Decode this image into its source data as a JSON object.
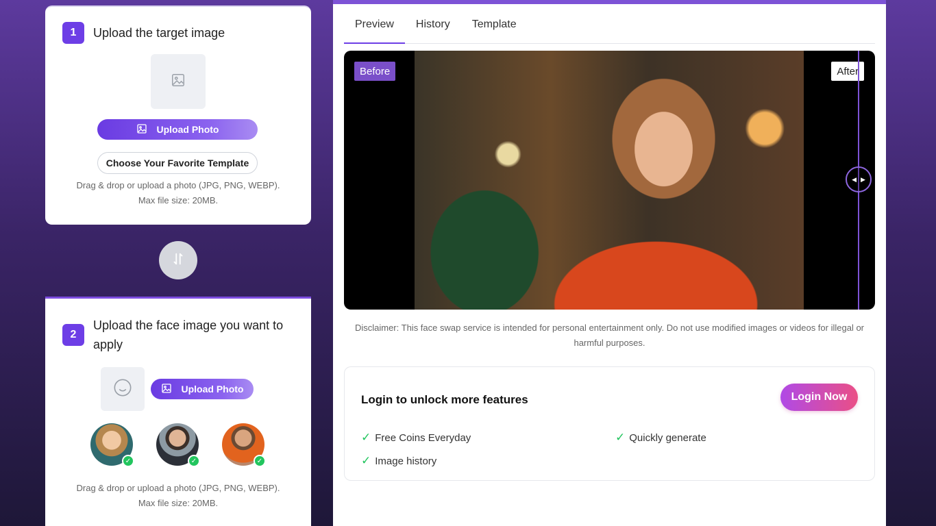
{
  "step1": {
    "number": "1",
    "title": "Upload the target image",
    "upload_label": "Upload Photo",
    "template_label": "Choose Your Favorite Template",
    "hint_line1": "Drag & drop or upload a photo (JPG, PNG, WEBP).",
    "hint_line2": "Max file size: 20MB."
  },
  "step2": {
    "number": "2",
    "title": "Upload the face image you want to apply",
    "upload_label": "Upload Photo",
    "hint_line1": "Drag & drop or upload a photo (JPG, PNG, WEBP).",
    "hint_line2": "Max file size: 20MB.",
    "face_presets": 3
  },
  "tabs": [
    "Preview",
    "History",
    "Template"
  ],
  "active_tab": "Preview",
  "preview": {
    "before_label": "Before",
    "after_label": "After"
  },
  "disclaimer": "Disclaimer: This face swap service is intended for personal entertainment only. Do not use modified images or videos for illegal or harmful purposes.",
  "login": {
    "title": "Login to unlock more features",
    "button_label": "Login Now",
    "features": [
      "Free Coins Everyday",
      "Quickly generate",
      "Image history"
    ]
  },
  "colors": {
    "accent": "#6d3ee6",
    "login_gradient_start": "#b04ae6",
    "login_gradient_end": "#ea4f86",
    "check_green": "#22c55e"
  }
}
